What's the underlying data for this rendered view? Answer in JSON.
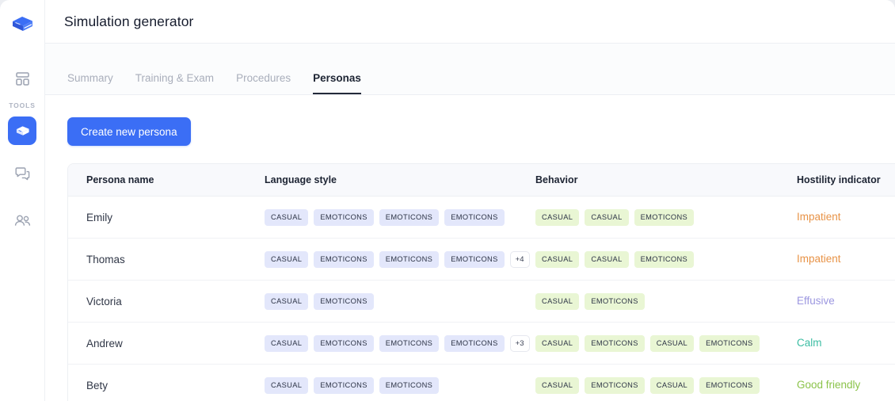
{
  "sidebar": {
    "logo_name": "book-logo",
    "section_label": "TOOLS",
    "items": [
      {
        "name": "dashboard",
        "icon": "dashboard-icon"
      },
      {
        "name": "simulation-generator",
        "icon": "graduation-cap-icon"
      },
      {
        "name": "conversations",
        "icon": "chat-bubbles-icon"
      },
      {
        "name": "users",
        "icon": "people-icon"
      }
    ]
  },
  "header": {
    "title": "Simulation generator"
  },
  "tabs": [
    {
      "label": "Summary",
      "active": false
    },
    {
      "label": "Training & Exam",
      "active": false
    },
    {
      "label": "Procedures",
      "active": false
    },
    {
      "label": "Personas",
      "active": true
    }
  ],
  "actions": {
    "create_persona_label": "Create new persona"
  },
  "table": {
    "columns": [
      "Persona name",
      "Language style",
      "Behavior",
      "Hostility indicator"
    ],
    "rows": [
      {
        "name": "Emily",
        "language_style": [
          "CASUAL",
          "EMOTICONS",
          "EMOTICONS",
          "EMOTICONS"
        ],
        "language_more": "",
        "behavior": [
          "CASUAL",
          "CASUAL",
          "EMOTICONS"
        ],
        "behavior_more": "",
        "hostility": "Impatient",
        "hostility_color": "#e89347"
      },
      {
        "name": "Thomas",
        "language_style": [
          "CASUAL",
          "EMOTICONS",
          "EMOTICONS",
          "EMOTICONS"
        ],
        "language_more": "+4",
        "behavior": [
          "CASUAL",
          "CASUAL",
          "EMOTICONS"
        ],
        "behavior_more": "",
        "hostility": "Impatient",
        "hostility_color": "#e89347"
      },
      {
        "name": "Victoria",
        "language_style": [
          "CASUAL",
          "EMOTICONS"
        ],
        "language_more": "",
        "behavior": [
          "CASUAL",
          "EMOTICONS"
        ],
        "behavior_more": "",
        "hostility": "Effusive",
        "hostility_color": "#9c97e0"
      },
      {
        "name": "Andrew",
        "language_style": [
          "CASUAL",
          "EMOTICONS",
          "EMOTICONS",
          "EMOTICONS"
        ],
        "language_more": "+3",
        "behavior": [
          "CASUAL",
          "EMOTICONS",
          "CASUAL",
          "EMOTICONS"
        ],
        "behavior_more": "",
        "hostility": "Calm",
        "hostility_color": "#3cbda3"
      },
      {
        "name": "Bety",
        "language_style": [
          "CASUAL",
          "EMOTICONS",
          "EMOTICONS"
        ],
        "language_more": "",
        "behavior": [
          "CASUAL",
          "EMOTICONS",
          "CASUAL",
          "EMOTICONS"
        ],
        "behavior_more": "",
        "hostility": "Good friendly",
        "hostility_color": "#8bc34a"
      }
    ]
  },
  "colors": {
    "accent": "#3b6ef5",
    "lang_chip_bg": "#e3e7fb",
    "behavior_chip_bg": "#e9f6d4",
    "active_tab": "#232a3a"
  }
}
